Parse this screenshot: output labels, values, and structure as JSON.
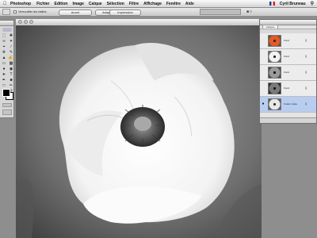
{
  "menubar": {
    "apple_icon": "apple-icon",
    "app": "Photoshop",
    "items": [
      "Fichier",
      "Edition",
      "Image",
      "Calque",
      "Sélection",
      "Filtre",
      "Affichage",
      "Fenêtre",
      "Aide"
    ],
    "user": "Cyril Bruneau"
  },
  "options": {
    "checkbox_label": "Verrouiller les tailles",
    "buttons": [
      "Ancré",
      "Adapter à l'écran",
      "Impression"
    ]
  },
  "document": {
    "title": ""
  },
  "layers_panel": {
    "tab": "Calques",
    "layers": [
      {
        "name": "Fond",
        "mark": "§",
        "visible": false,
        "selected": false,
        "thumb": "red"
      },
      {
        "name": "Fond",
        "mark": "§",
        "visible": false,
        "selected": false,
        "thumb": "gray1"
      },
      {
        "name": "Fond",
        "mark": "§",
        "visible": false,
        "selected": false,
        "thumb": "gray2"
      },
      {
        "name": "Fond",
        "mark": "§",
        "visible": false,
        "selected": false,
        "thumb": "gray3"
      },
      {
        "name": "Fusion copie",
        "mark": "§",
        "visible": true,
        "selected": true,
        "thumb": "gray4"
      }
    ]
  },
  "colors": {
    "selection": "#b9cdf0",
    "poppy_red": "#d9471f"
  }
}
